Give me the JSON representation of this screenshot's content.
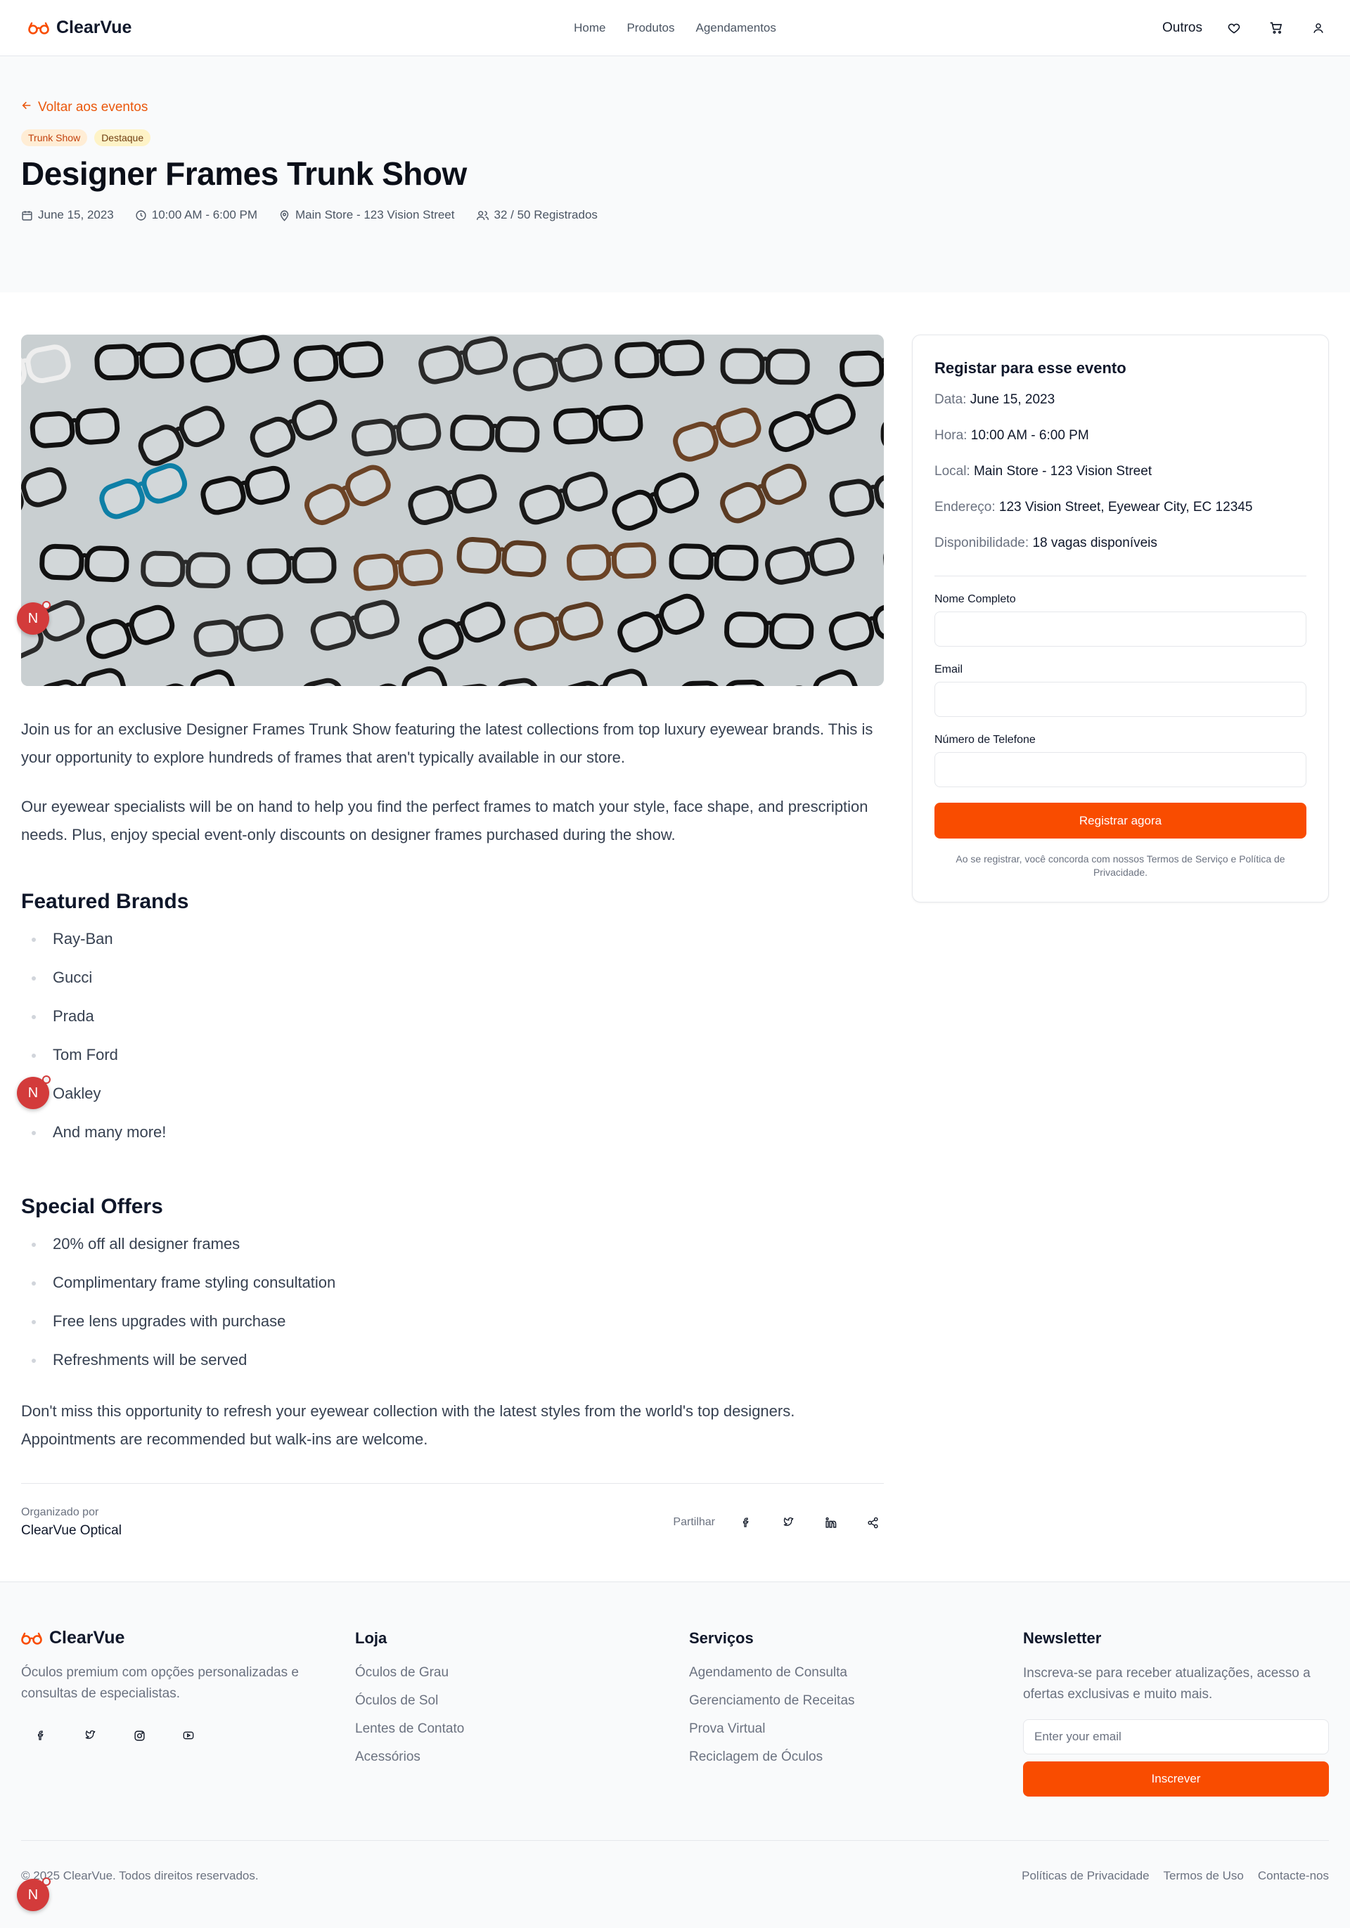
{
  "header": {
    "brand": "ClearVue",
    "nav": [
      "Home",
      "Produtos",
      "Agendamentos"
    ],
    "more": "Outros",
    "icons": [
      "heart-icon",
      "cart-icon",
      "user-icon"
    ]
  },
  "event": {
    "back_label": "Voltar aos eventos",
    "badges": [
      "Trunk Show",
      "Destaque"
    ],
    "title": "Designer Frames Trunk Show",
    "date": "June 15, 2023",
    "time": "10:00 AM - 6:00 PM",
    "location": "Main Store - 123 Vision Street",
    "registered": "32 / 50 Registrados"
  },
  "content": {
    "intro1": "Join us for an exclusive Designer Frames Trunk Show featuring the latest collections from top luxury eyewear brands. This is your opportunity to explore hundreds of frames that aren't typically available in our store.",
    "intro2": "Our eyewear specialists will be on hand to help you find the perfect frames to match your style, face shape, and prescription needs. Plus, enjoy special event-only discounts on designer frames purchased during the show.",
    "brands_title": "Featured Brands",
    "brands": [
      "Ray-Ban",
      "Gucci",
      "Prada",
      "Tom Ford",
      "Oakley",
      "And many more!"
    ],
    "offers_title": "Special Offers",
    "offers": [
      "20% off all designer frames",
      "Complimentary frame styling consultation",
      "Free lens upgrades with purchase",
      "Refreshments will be served"
    ],
    "closing": "Don't miss this opportunity to refresh your eyewear collection with the latest styles from the world's top designers. Appointments are recommended but walk-ins are welcome.",
    "organized_by_label": "Organizado por",
    "organizer": "ClearVue Optical",
    "share_label": "Partilhar"
  },
  "registration": {
    "title": "Registar para esse evento",
    "date_label": "Data:",
    "date": "June 15, 2023",
    "time_label": "Hora:",
    "time": "10:00 AM - 6:00 PM",
    "place_label": "Local:",
    "place": "Main Store - 123 Vision Street",
    "address_label": "Endereço:",
    "address": "123 Vision Street, Eyewear City, EC 12345",
    "availability_label": "Disponibilidade:",
    "availability": "18 vagas disponíveis",
    "name_label": "Nome Completo",
    "name_value": "",
    "email_label": "Email",
    "email_value": "",
    "phone_label": "Número de Telefone",
    "phone_value": "",
    "submit": "Registrar agora",
    "note": "Ao se registrar, você concorda com nossos Termos de Serviço e Política de Privacidade."
  },
  "footer": {
    "brand": "ClearVue",
    "description": "Óculos premium com opções personalizadas e consultas de especialistas.",
    "shop_title": "Loja",
    "shop_links": [
      "Óculos de Grau",
      "Óculos de Sol",
      "Lentes de Contato",
      "Acessórios"
    ],
    "services_title": "Serviços",
    "services_links": [
      "Agendamento de Consulta",
      "Gerenciamento de Receitas",
      "Prova Virtual",
      "Reciclagem de Óculos"
    ],
    "newsletter_title": "Newsletter",
    "newsletter_text": "Inscreva-se para receber atualizações, acesso a ofertas exclusivas e muito mais.",
    "email_placeholder": "Enter your email",
    "subscribe": "Inscrever",
    "copyright": "© 2025 ClearVue. Todos direitos reservados.",
    "legal": [
      "Políticas de Privacidade",
      "Termos de Uso",
      "Contacte-nos"
    ]
  },
  "floating_badge": "N",
  "colors": {
    "accent": "#f94c00",
    "accent_text": "#ea580c",
    "badge_red": "#d33b3b"
  }
}
